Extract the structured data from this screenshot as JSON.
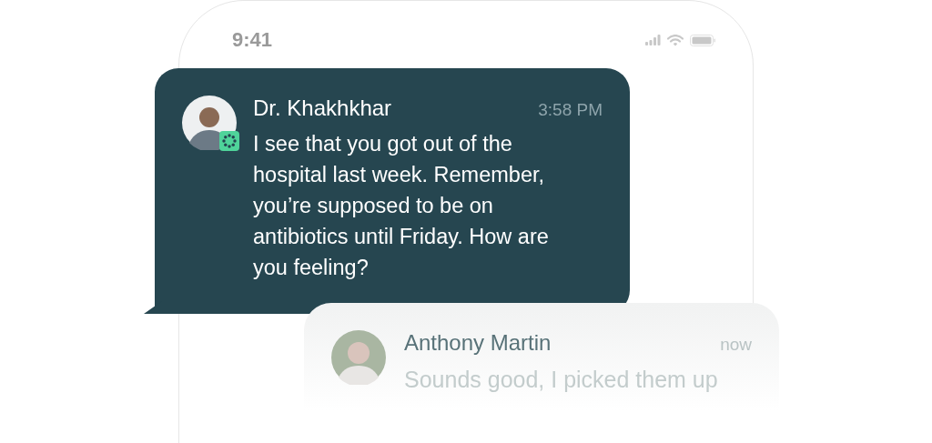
{
  "status_bar": {
    "time": "9:41"
  },
  "messages": [
    {
      "kind": "incoming",
      "sender": "Dr. Khakhkhar",
      "time": "3:58 PM",
      "text": "I see that you got out of the hospital last week. Remember, you’re supposed to be on antibiotics until Friday. How are you feeling?"
    },
    {
      "kind": "reply",
      "sender": "Anthony Martin",
      "time": "now",
      "text": "Sounds good, I picked them up"
    }
  ]
}
